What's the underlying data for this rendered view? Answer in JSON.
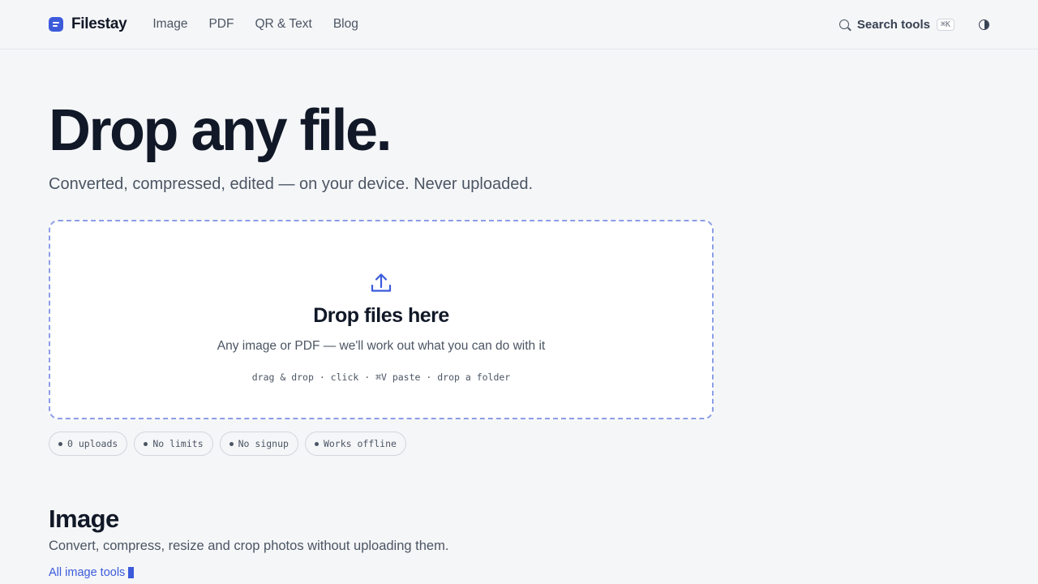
{
  "brand": {
    "name": "Filestay"
  },
  "nav": {
    "items": [
      {
        "label": "Image"
      },
      {
        "label": "PDF"
      },
      {
        "label": "QR & Text"
      },
      {
        "label": "Blog"
      }
    ]
  },
  "search": {
    "label": "Search tools",
    "shortcut": "⌘K"
  },
  "hero": {
    "title": "Drop any file.",
    "subtitle": "Converted, compressed, edited — on your device. Never uploaded."
  },
  "dropzone": {
    "title": "Drop files here",
    "subtitle": "Any image or PDF — we'll work out what you can do with it",
    "hint": "drag & drop · click · ⌘V paste · drop a folder"
  },
  "chips": [
    {
      "label": "0 uploads"
    },
    {
      "label": "No limits"
    },
    {
      "label": "No signup"
    },
    {
      "label": "Works offline"
    }
  ],
  "section": {
    "title": "Image",
    "subtitle": "Convert, compress, resize and crop photos without uploading them.",
    "link": "All image tools"
  },
  "colors": {
    "accent": "#3b5bdb",
    "dashed_border": "#8b9ee6",
    "background": "#f5f6f8"
  }
}
